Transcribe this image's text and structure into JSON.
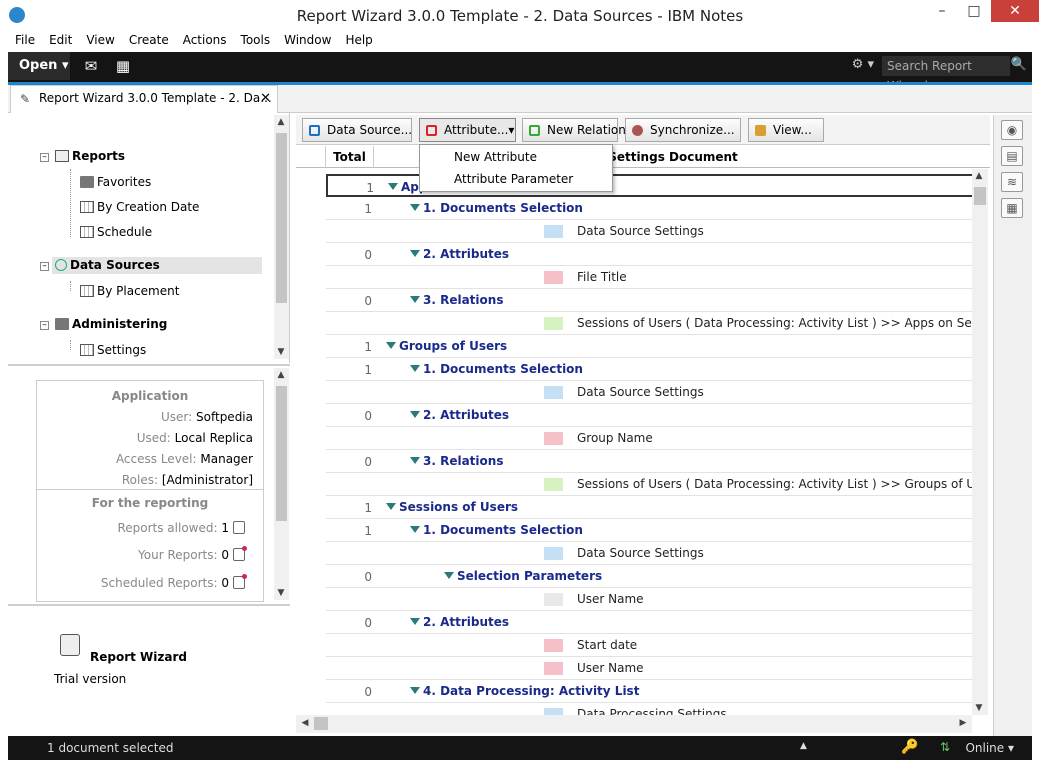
{
  "window": {
    "title": "Report Wizard 3.0.0 Template - 2. Data Sources - IBM Notes",
    "minimize": "–",
    "maximize": "□",
    "close": "✕"
  },
  "menu": [
    "File",
    "Edit",
    "View",
    "Create",
    "Actions",
    "Tools",
    "Window",
    "Help"
  ],
  "toolbar": {
    "open_label": "Open ▾",
    "mail_icon": "envelope-icon",
    "calendar_icon": "calendar-icon",
    "search_placeholder": "Search Report Wizard",
    "tools_glyph": "⚙ ▾",
    "search_glyph": "🔍"
  },
  "tab": {
    "label": "Report Wizard 3.0.0 Template - 2. Da...",
    "close": "✕"
  },
  "nav": {
    "reports": "Reports",
    "favorites": "Favorites",
    "by_creation_date": "By Creation Date",
    "schedule": "Schedule",
    "data_sources": "Data Sources",
    "by_placement": "By Placement",
    "administering": "Administering",
    "settings": "Settings",
    "collapse": "⊟"
  },
  "info": {
    "application_header": "Application",
    "user_label": "User:",
    "user_value": "Softpedia",
    "used_label": "Used:",
    "used_value": "Local Replica",
    "access_label": "Access Level:",
    "access_value": "Manager",
    "roles_label": "Roles:",
    "roles_value": "[Administrator]",
    "reporting_header": "For the reporting",
    "allowed_label": "Reports allowed:",
    "allowed_value": "1",
    "your_label": "Your Reports:",
    "your_value": "0",
    "scheduled_label": "Scheduled Reports:",
    "scheduled_value": "0"
  },
  "about": {
    "name": "Report Wizard",
    "edition": "Trial version"
  },
  "actions": {
    "data_source": "Data Source...",
    "attribute": "Attribute...▾",
    "new_relation": "New Relation",
    "synchronize": "Synchronize...",
    "view": "View..."
  },
  "dropdown": {
    "new_attribute": "New Attribute",
    "attribute_parameter": "Attribute Parameter"
  },
  "columns": {
    "total": "Total",
    "settings_document": "Settings Document"
  },
  "colors": {
    "blue_swatch": "#c5dff5",
    "pink_swatch": "#f5c0c8",
    "green_swatch": "#d6f2c0",
    "grey_swatch": "#e8e8e8",
    "accent": "#1f87c9",
    "category_text": "#1a2a8a"
  },
  "rows": [
    {
      "count": "1",
      "label": "Apps",
      "level": 0
    },
    {
      "count": "1",
      "label": "1. Documents Selection",
      "level": 1
    },
    {
      "doc": "Data Source Settings",
      "swatch": "blue"
    },
    {
      "count": "0",
      "label": "2. Attributes",
      "level": 1
    },
    {
      "doc": "File Title",
      "swatch": "pink"
    },
    {
      "count": "0",
      "label": "3. Relations",
      "level": 1
    },
    {
      "doc": "Sessions of Users ( Data Processing: Activity List ) >> Apps on Servers",
      "swatch": "green"
    },
    {
      "count": "1",
      "label": "Groups of Users",
      "level": 0
    },
    {
      "count": "1",
      "label": "1. Documents Selection",
      "level": 1
    },
    {
      "doc": "Data Source Settings",
      "swatch": "blue"
    },
    {
      "count": "0",
      "label": "2. Attributes",
      "level": 1
    },
    {
      "doc": "Group Name",
      "swatch": "pink"
    },
    {
      "count": "0",
      "label": "3. Relations",
      "level": 1
    },
    {
      "doc": "Sessions of Users ( Data Processing: Activity List ) >> Groups of Users",
      "swatch": "green"
    },
    {
      "count": "1",
      "label": "Sessions of Users",
      "level": 0
    },
    {
      "count": "1",
      "label": "1. Documents Selection",
      "level": 1
    },
    {
      "doc": "Data Source Settings",
      "swatch": "blue"
    },
    {
      "count": "0",
      "label": "Selection Parameters",
      "level": 2
    },
    {
      "doc": "User Name",
      "swatch": "grey"
    },
    {
      "count": "0",
      "label": "2. Attributes",
      "level": 1
    },
    {
      "doc": "Start date",
      "swatch": "pink"
    },
    {
      "doc": "User Name",
      "swatch": "pink"
    },
    {
      "count": "0",
      "label": "4. Data Processing: Activity List",
      "level": 1
    },
    {
      "doc": "Data Processing Settings",
      "swatch": "blue"
    }
  ],
  "status": {
    "message": "1 document selected",
    "up_glyph": "▲",
    "key_glyph": "🔑",
    "online": "Online ▾"
  },
  "scroll": {
    "up": "▲",
    "down": "▼",
    "left": "◀",
    "right": "▶"
  }
}
